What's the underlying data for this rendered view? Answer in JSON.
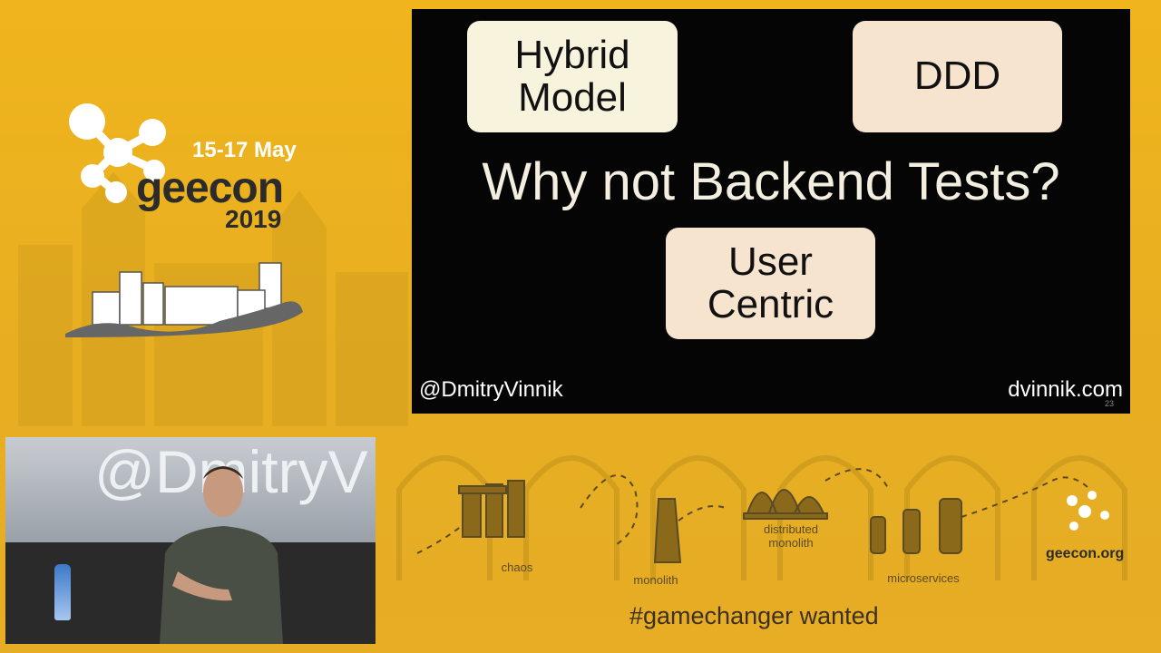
{
  "conference": {
    "dates": "15-17 May",
    "name": "geecon",
    "year": "2019"
  },
  "slide": {
    "title": "Why not Backend Tests?",
    "boxes": {
      "hybrid": "Hybrid Model",
      "ddd": "DDD",
      "user": "User Centric"
    },
    "handle": "@DmitryVinnik",
    "site": "dvinnik.com",
    "page_number": "23"
  },
  "video": {
    "projection_text": "@DmitryV"
  },
  "timeline": {
    "stages": [
      "chaos",
      "monolith",
      "distributed monolith",
      "microservices"
    ],
    "hashtag": "#gamechanger wanted",
    "url": "geecon.org"
  },
  "colors": {
    "background": "#e8b21f",
    "slide": "#050505",
    "box_cream": "#f7f3dc",
    "box_peach": "#f6e4cf"
  }
}
